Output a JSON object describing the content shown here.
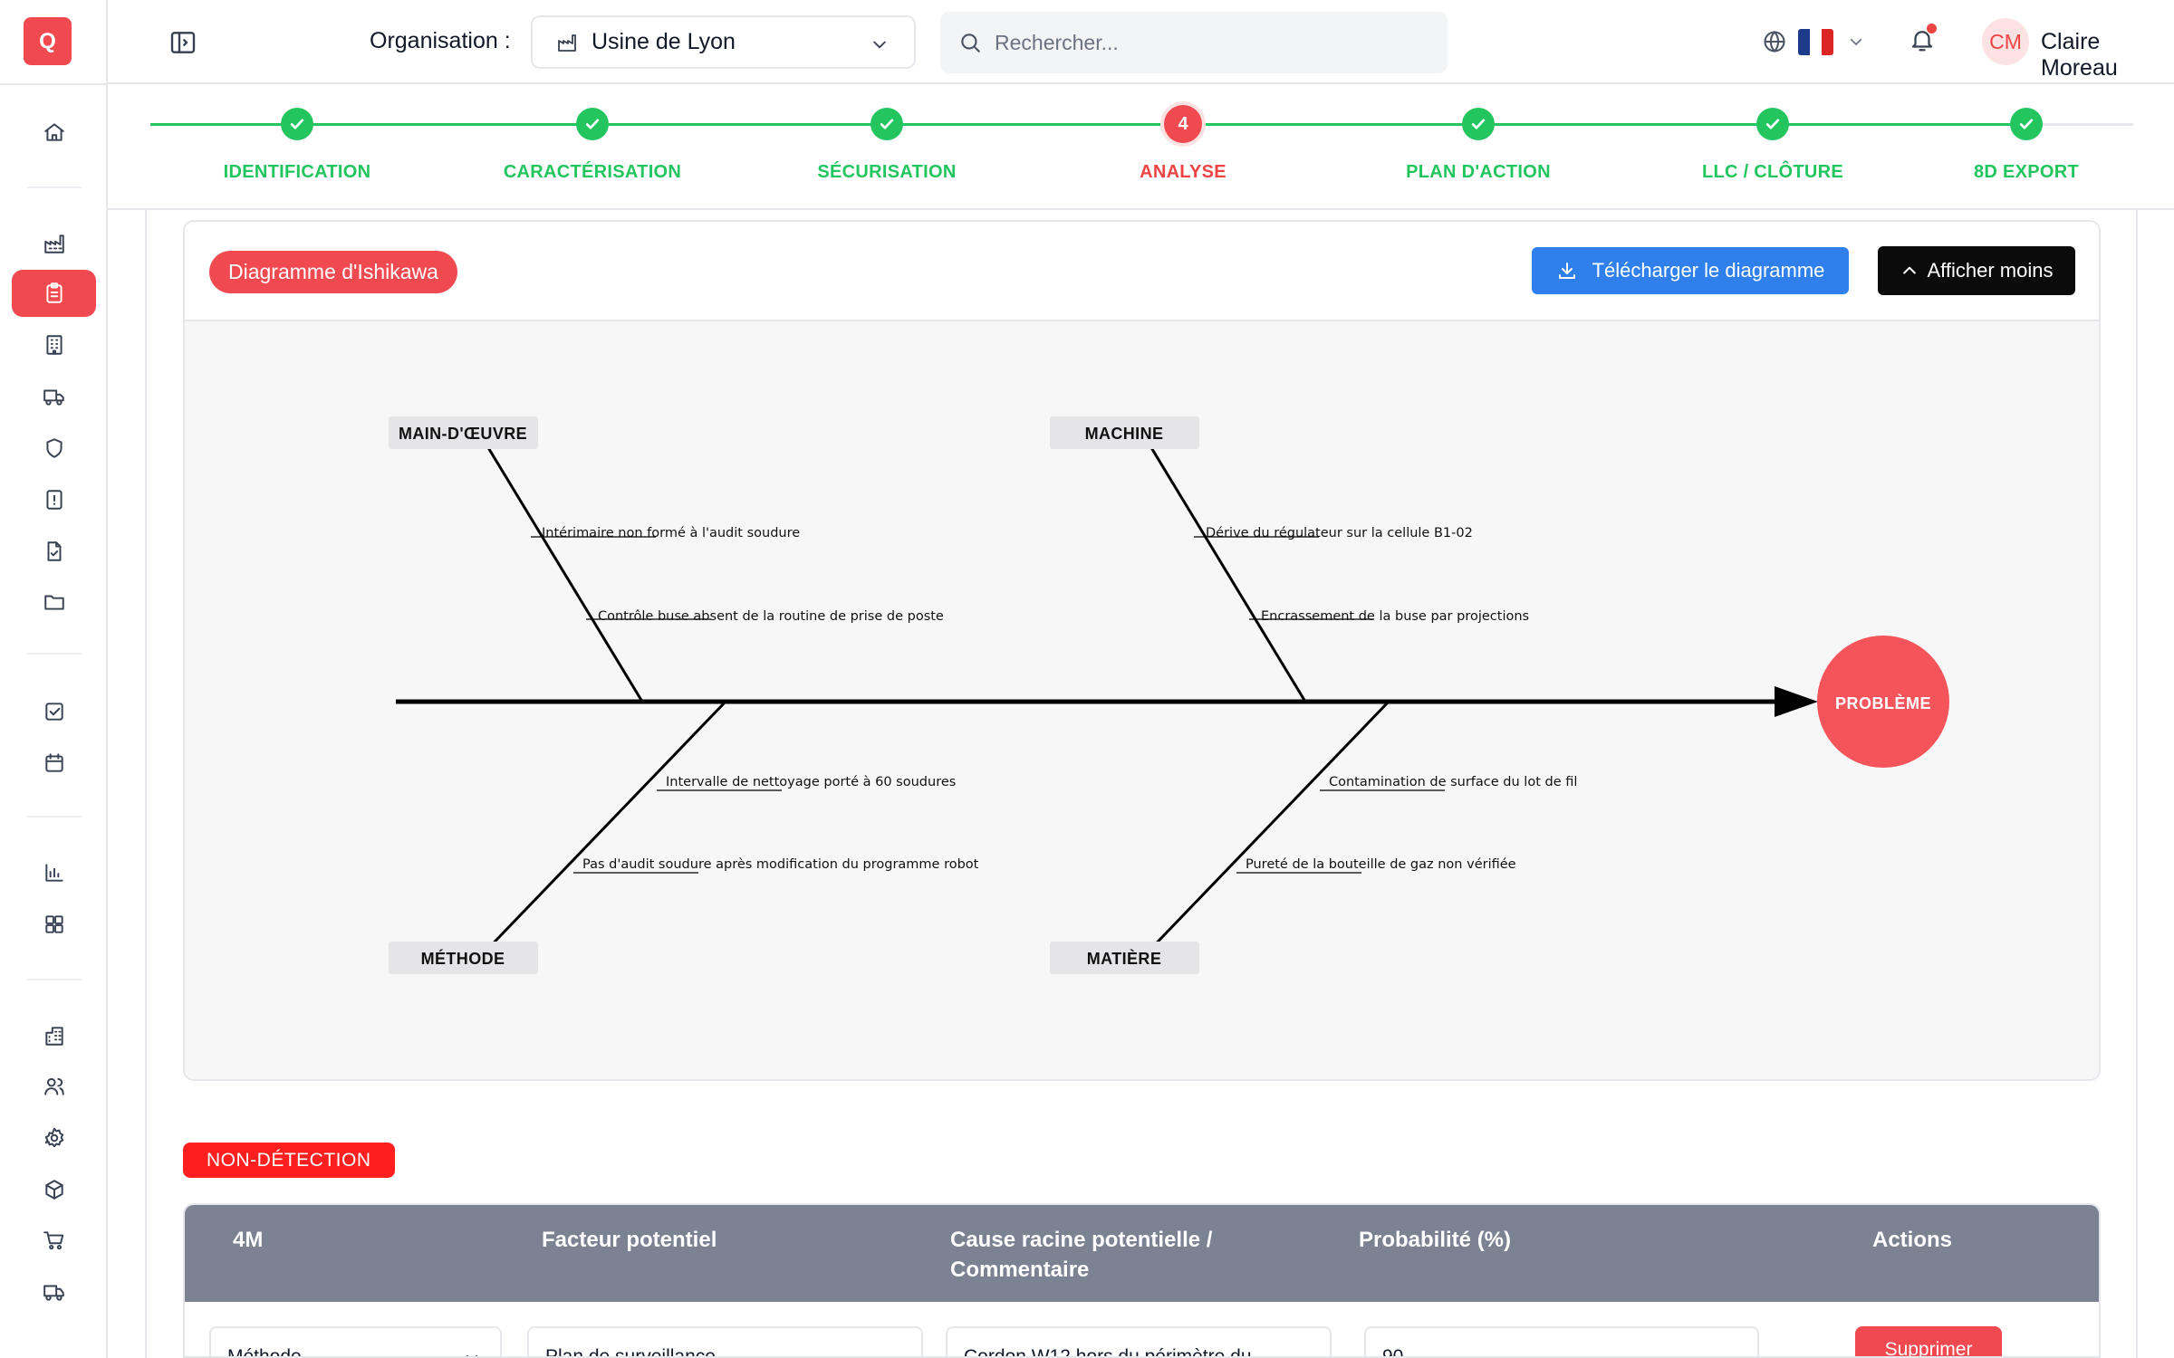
{
  "app": {
    "logo_letter": "Q"
  },
  "sidebar": {
    "items": [
      {
        "icon": "home-icon"
      },
      {
        "icon": "factory-icon"
      },
      {
        "icon": "clipboard-icon",
        "active": true
      },
      {
        "icon": "building-icon"
      },
      {
        "icon": "truck-icon"
      },
      {
        "icon": "shield-icon"
      },
      {
        "icon": "alert-file-icon"
      },
      {
        "icon": "file-check-icon"
      },
      {
        "icon": "folder-icon"
      },
      {
        "icon": "checkbox-icon"
      },
      {
        "icon": "calendar-icon"
      },
      {
        "icon": "bar-chart-icon"
      },
      {
        "icon": "grid-icon"
      },
      {
        "icon": "building-2-icon"
      },
      {
        "icon": "users-icon"
      },
      {
        "icon": "settings-icon"
      },
      {
        "icon": "package-icon"
      },
      {
        "icon": "cart-icon"
      },
      {
        "icon": "delivery-truck-icon"
      }
    ]
  },
  "header": {
    "org_label": "Organisation :",
    "org_value": "Usine de Lyon",
    "search_placeholder": "Rechercher...",
    "flag_colors": [
      "#1e3a8a",
      "#ffffff",
      "#dc2626"
    ],
    "user_initials": "CM",
    "user_name": "Claire Moreau"
  },
  "stepper": {
    "steps": [
      {
        "label": "IDENTIFICATION",
        "status": "done"
      },
      {
        "label": "CARACTÉRISATION",
        "status": "done"
      },
      {
        "label": "SÉCURISATION",
        "status": "done"
      },
      {
        "label": "ANALYSE",
        "status": "current",
        "number": "4"
      },
      {
        "label": "PLAN D'ACTION",
        "status": "done"
      },
      {
        "label": "LLC / CLÔTURE",
        "status": "done"
      },
      {
        "label": "8D EXPORT",
        "status": "done"
      }
    ],
    "colors": {
      "done": "#22c55e",
      "current": "#f0494f"
    }
  },
  "ishikawa": {
    "title": "Diagramme d'Ishikawa",
    "download_label": "Télécharger le diagramme",
    "collapse_label": "Afficher moins",
    "problem_label": "PROBLÈME",
    "categories": [
      {
        "name": "MAIN-D'ŒUVRE",
        "position": "top",
        "causes": [
          "Intérimaire non formé à l'audit soudure",
          "Contrôle buse absent de la routine de prise de poste"
        ]
      },
      {
        "name": "MACHINE",
        "position": "top",
        "causes": [
          "Dérive du régulateur sur la cellule B1-02",
          "Encrassement de la buse par projections"
        ]
      },
      {
        "name": "MÉTHODE",
        "position": "bottom",
        "causes": [
          "Intervalle de nettoyage porté à 60 soudures",
          "Pas d'audit soudure après modification du programme robot"
        ]
      },
      {
        "name": "MATIÈRE",
        "position": "bottom",
        "causes": [
          "Contamination de surface du lot de fil",
          "Pureté de la bouteille de gaz non vérifiée"
        ]
      }
    ]
  },
  "non_detection": {
    "badge": "NON-DÉTECTION",
    "columns": [
      "4M",
      "Facteur potentiel",
      "Cause racine potentielle / Commentaire",
      "Probabilité (%)",
      "Actions"
    ],
    "row": {
      "m4": "Méthode",
      "factor": "Plan de surveillance",
      "cause": "Cordon W12 hors du périmètre du",
      "probability": "90",
      "delete_label": "Supprimer"
    }
  }
}
